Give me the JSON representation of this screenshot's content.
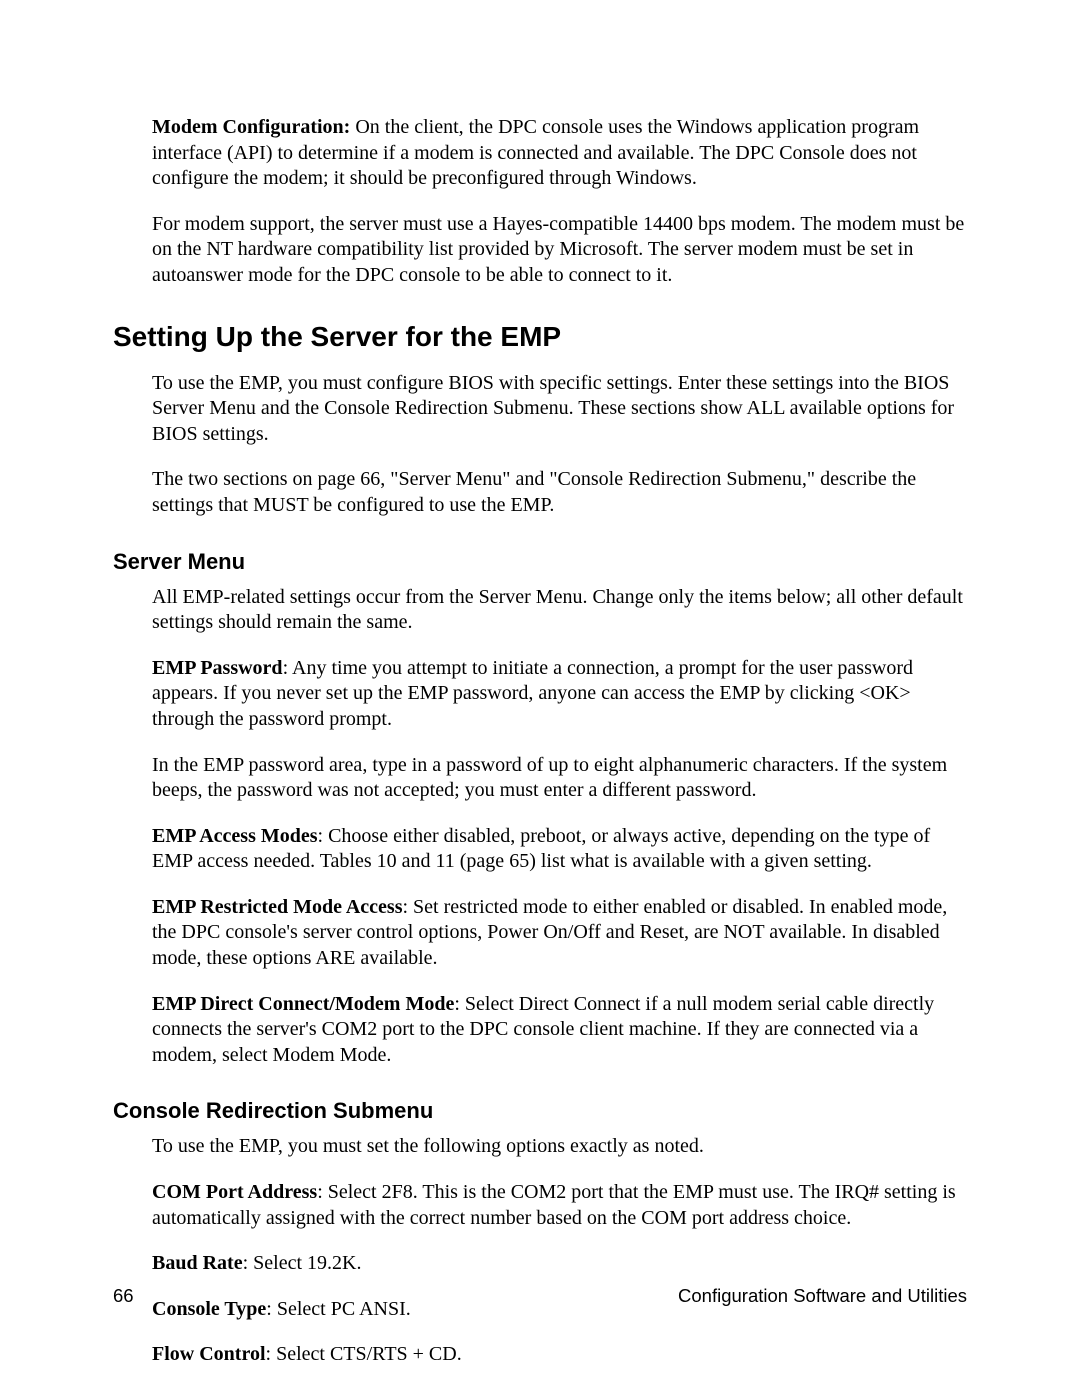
{
  "para1_label": "Modem Configuration:",
  "para1_rest": "  On the client, the DPC console uses the Windows application program interface (API) to determine if a modem is connected and available.  The DPC Console does not configure the modem; it should be preconfigured through Windows.",
  "para2": "For modem support, the server must use a Hayes-compatible 14400 bps modem.  The modem must be on the NT hardware compatibility list provided by Microsoft.  The server modem must be set in autoanswer mode for the DPC console to be able to connect to it.",
  "h1": "Setting Up the Server for the EMP",
  "para3": "To use the EMP, you must configure BIOS with specific settings.  Enter these settings into the BIOS Server Menu and the Console Redirection Submenu.  These sections show ALL available options for BIOS settings.",
  "para4": "The two sections on page 66, \"Server Menu\" and \"Console Redirection Submenu,\" describe the settings that MUST be configured to use the EMP.",
  "h2a": "Server Menu",
  "sm_p1": "All EMP-related settings occur from the Server Menu.  Change only the items below; all other default settings should remain the same.",
  "sm_p2_label": "EMP Password",
  "sm_p2_rest": ":  Any time you attempt to initiate a connection, a prompt for the user password appears.  If you never set up the EMP password, anyone can access the EMP by clicking <OK> through the password prompt.",
  "sm_p3": "In the EMP password area, type in a password of up to eight alphanumeric characters.  If the system beeps, the password was not accepted; you must enter a different password.",
  "sm_p4_label": "EMP Access Modes",
  "sm_p4_rest": ":  Choose either disabled, preboot, or always active, depending on the type of EMP access needed.  Tables 10 and 11 (page 65) list what is available with a given setting.",
  "sm_p5_label": "EMP Restricted Mode Access",
  "sm_p5_rest": ":  Set restricted mode to either enabled or disabled.  In enabled mode, the DPC console's server control options, Power On/Off and Reset, are NOT available.  In disabled mode, these options ARE available.",
  "sm_p6_label": "EMP Direct Connect/Modem Mode",
  "sm_p6_rest": ":  Select Direct Connect if a null modem serial cable directly connects the server's COM2 port to the DPC console client machine.  If they are connected via a modem, select Modem Mode.",
  "h2b": "Console Redirection Submenu",
  "cr_p1": "To use the EMP, you must set the following options exactly as noted.",
  "cr_p2_label": "COM Port Address",
  "cr_p2_rest": ":  Select 2F8.  This is the COM2 port that the EMP must use.  The IRQ# setting is automatically assigned with the correct number based on the COM port address choice.",
  "cr_p3_label": "Baud Rate",
  "cr_p3_rest": ":  Select 19.2K.",
  "cr_p4_label": "Console Type",
  "cr_p4_rest": ":  Select PC ANSI.",
  "cr_p5_label": "Flow Control",
  "cr_p5_rest": ":  Select CTS/RTS + CD.",
  "footer_page": "66",
  "footer_title": "Configuration Software and Utilities"
}
